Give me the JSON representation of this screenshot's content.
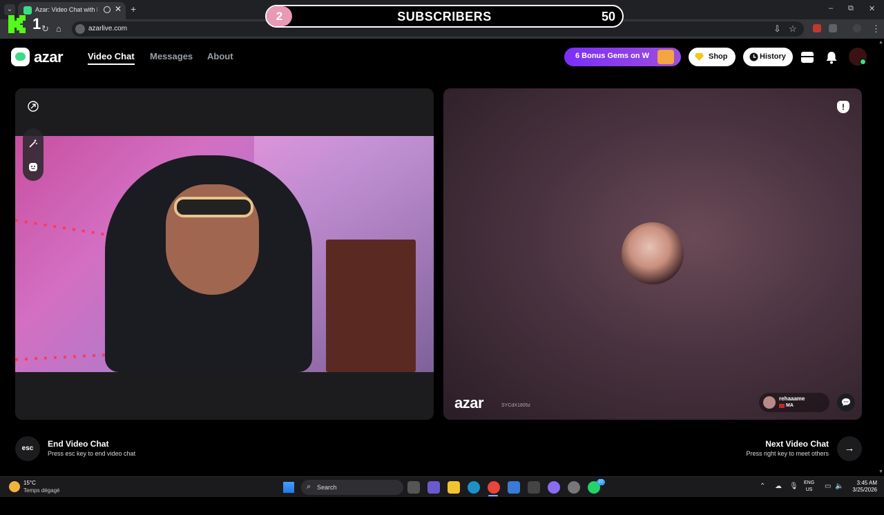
{
  "browser": {
    "tab_title": "Azar: Video Chat with New",
    "tab_close": "✕",
    "new_tab": "+",
    "url": "azarlive.com",
    "window_controls": [
      "–",
      "⧉",
      "✕"
    ]
  },
  "overlay": {
    "left_counter": "1",
    "circle_number": "2",
    "label": "SUBSCRIBERS",
    "count": "50"
  },
  "header": {
    "brand": "azar",
    "nav": [
      "Video Chat",
      "Messages",
      "About"
    ],
    "promo": "6 Bonus Gems on W",
    "shop": "Shop",
    "history": "History"
  },
  "remote": {
    "watermark": "azar",
    "session_id": "SYCdX1805z",
    "partner_name": "rehaaame",
    "partner_country": "MA"
  },
  "controls": {
    "esc_label": "esc",
    "end_title": "End Video Chat",
    "end_sub": "Press esc key to end video chat",
    "next_title": "Next Video Chat",
    "next_sub": "Press right key to meet others"
  },
  "taskbar": {
    "temperature": "15°C",
    "weather": "Temps dégagé",
    "search": "Search",
    "lang": "ENG",
    "region": "US",
    "time": "3:45 AM",
    "date": "3/25/2026",
    "notification_count": "27"
  },
  "colors": {
    "accent_green": "#3ddc84",
    "promo_purple": "#7b2ff7",
    "overlay_pink": "#e89ab4"
  }
}
